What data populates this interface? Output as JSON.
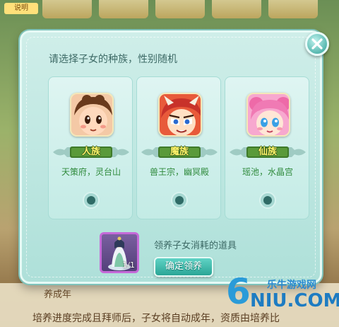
{
  "background": {
    "tag": "说明",
    "caption": "养成年",
    "bottom_text": "培养进度完成且拜师后，子女将自动成年，资质由培养比"
  },
  "dialog": {
    "title": "请选择子女的种族，性别随机",
    "close_icon": "close-icon",
    "races": [
      {
        "name": "人族",
        "location": "天策府，灵台山",
        "avatar_icon": "human-child-avatar"
      },
      {
        "name": "魔族",
        "location": "兽王宗，幽冥殿",
        "avatar_icon": "demon-child-avatar"
      },
      {
        "name": "仙族",
        "location": "瑶池，水晶宫",
        "avatar_icon": "immortal-child-avatar"
      }
    ],
    "item": {
      "description": "领养子女消耗的道具",
      "count": "1/1",
      "icon": "guanyin-statue-icon"
    },
    "confirm_label": "确定领养"
  },
  "watermark": {
    "digit": "6",
    "cn": "乐牛游戏网",
    "en": "NIU.COM"
  },
  "colors": {
    "dialog_bg": "#bfe8e2",
    "accent_teal": "#2aa596",
    "race_text": "#fff36a",
    "location_text": "#2f8a3c"
  }
}
